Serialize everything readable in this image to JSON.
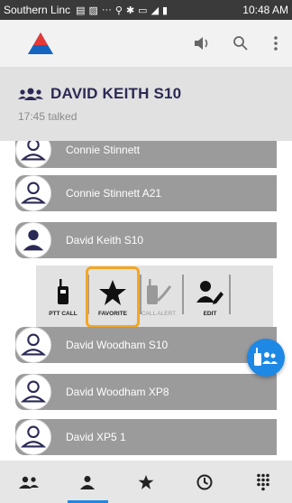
{
  "status_bar": {
    "carrier": "Southern Linc",
    "time": "10:48 AM"
  },
  "header": {
    "group_name": "DAVID KEITH S10",
    "status": "17:45 talked"
  },
  "contacts": [
    {
      "name": "Connie Stinnett",
      "selected": false
    },
    {
      "name": "Connie Stinnett A21",
      "selected": false
    },
    {
      "name": "David Keith S10",
      "selected": true
    },
    {
      "name": "David Woodham S10",
      "selected": false
    },
    {
      "name": "David Woodham XP8",
      "selected": false
    },
    {
      "name": "David XP5 1",
      "selected": false
    }
  ],
  "actions": {
    "ptt_call": "PTT CALL",
    "favorite": "FAVORITE",
    "call_alert": "CALL ALERT",
    "edit": "EDIT"
  },
  "bottom_nav": [
    {
      "icon": "groups-icon",
      "active": false
    },
    {
      "icon": "person-icon",
      "active": true
    },
    {
      "icon": "star-icon",
      "active": false
    },
    {
      "icon": "clock-icon",
      "active": false
    },
    {
      "icon": "dialpad-icon",
      "active": false
    }
  ],
  "colors": {
    "accent": "#1e88e5",
    "highlight": "#f5a623",
    "row_bg": "#9b9b9b",
    "title": "#2b2a55"
  }
}
